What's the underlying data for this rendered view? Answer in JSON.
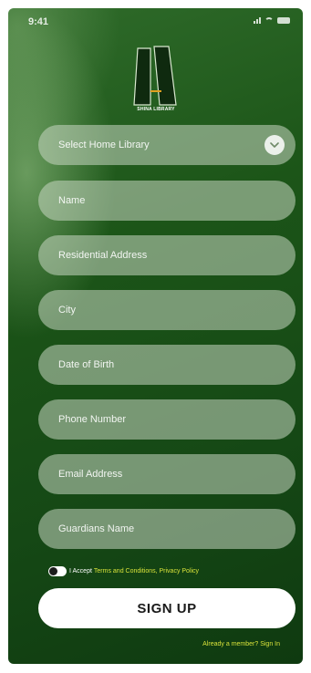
{
  "status_bar": {
    "time": "9:41"
  },
  "logo": {
    "caption": "SHINA LIBRARY",
    "accent_color": "#e0a020"
  },
  "form": {
    "home_library": {
      "placeholder": "Select Home Library",
      "icon": "chevron-down-icon"
    },
    "name": {
      "placeholder": "Name"
    },
    "residential_address": {
      "placeholder": "Residential Address"
    },
    "city": {
      "placeholder": "City"
    },
    "date_of_birth": {
      "placeholder": "Date of Birth"
    },
    "phone_number": {
      "placeholder": "Phone Number"
    },
    "email_address": {
      "placeholder": "Email Address"
    },
    "guardians_name": {
      "placeholder": "Guardians Name"
    }
  },
  "terms": {
    "prefix": "I Accept",
    "link_text": "Terms and Conditions, Privacy Policy",
    "accepted": false
  },
  "signup_button": {
    "label": "SIGN UP"
  },
  "signin": {
    "text": "Already a member? Sign In"
  },
  "colors": {
    "background": "#1c5518",
    "field": "#c8d7c3",
    "link": "#d8e23a",
    "button": "#ffffff"
  }
}
